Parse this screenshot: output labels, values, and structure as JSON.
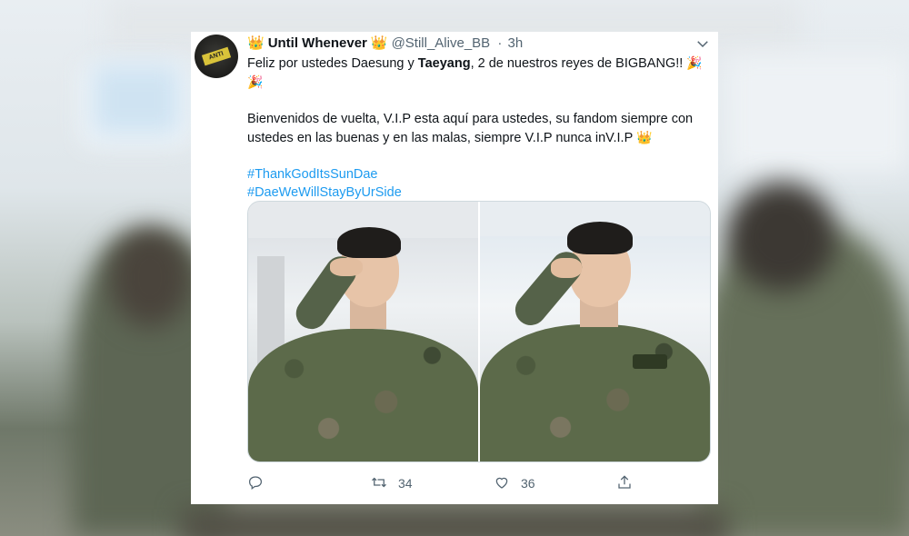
{
  "tweet": {
    "display_name": "Until Whenever",
    "crown_left": "👑",
    "crown_right": "👑",
    "handle": "@Still_Alive_BB",
    "separator": "·",
    "time": "3h",
    "text": {
      "line1_a": "Feliz por ustedes Daesung y ",
      "line1_bold": "Taeyang",
      "line1_b": ", 2 de nuestros reyes de BIGBANG!! ",
      "party_emoji": "🎉",
      "line2": " Bienvenidos de vuelta, V.I.P esta aquí para ustedes, su fandom siempre con ustedes en las buenas y en las malas, siempre V.I.P nunca inV.I.P ",
      "crown_emoji": "👑",
      "hashtags": [
        "#ThankGodItsSunDae",
        "#DaeWeWillStayByUrSide"
      ]
    },
    "avatar_badge": "ANTI"
  },
  "actions": {
    "reply_count": "",
    "retweet_count": "34",
    "like_count": "36"
  }
}
